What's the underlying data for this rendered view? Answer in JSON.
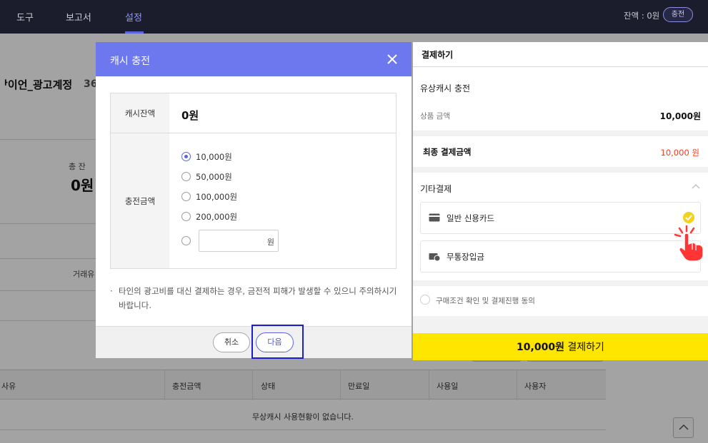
{
  "nav": {
    "items": [
      "도구",
      "보고서",
      "설정"
    ],
    "active_index": 2,
    "balance_label": "잔액 : 0원",
    "charge_button": "충전"
  },
  "background": {
    "account_title": "...ᅡ이언_광고계정",
    "account_number_partial": "36",
    "total_balance_label": "총 잔",
    "total_balance_value": "0원",
    "partial_column_label": "거래유",
    "table_headers": [
      "사유",
      "충전금액",
      "상태",
      "만료일",
      "사용일",
      "사용자"
    ],
    "empty_message": "무상캐시 사용현황이 없습니다."
  },
  "modal": {
    "title": "캐시 충전",
    "balance_label": "캐시잔액",
    "balance_value": "0원",
    "amount_label": "충전금액",
    "options": [
      "10,000원",
      "50,000원",
      "100,000원",
      "200,000원"
    ],
    "selected_option": 0,
    "custom_amount_value": "",
    "custom_amount_unit": "원",
    "notice": "타인의 광고비를 대신 결제하는 경우, 금전적 피해가 발생할 수 있으니 주의하시기 바랍니다.",
    "cancel_label": "취소",
    "next_label": "다음"
  },
  "payment": {
    "title": "결제하기",
    "product_name": "유상캐시 충전",
    "price_label": "상품 금액",
    "price_value": "10,000원",
    "final_label": "최종 결제금액",
    "final_value": "10,000 원",
    "other_methods_label": "기타결제",
    "methods": [
      {
        "label": "일반 신용카드",
        "icon": "credit-card-icon",
        "selected": true
      },
      {
        "label": "무통장입금",
        "icon": "bank-transfer-icon",
        "selected": false
      }
    ],
    "agreement_text": "구매조건 확인 및 결제진행 동의",
    "submit_amount": "10,000원",
    "submit_label": "결제하기"
  },
  "colors": {
    "nav_bg": "#1c1d2c",
    "modal_header": "#6d78ef",
    "accent": "#5a65e0",
    "final_amount": "#ff3a17",
    "check": "#f3d21b",
    "pay_button": "#ffe600",
    "highlight_box": "#1e1ec8"
  }
}
